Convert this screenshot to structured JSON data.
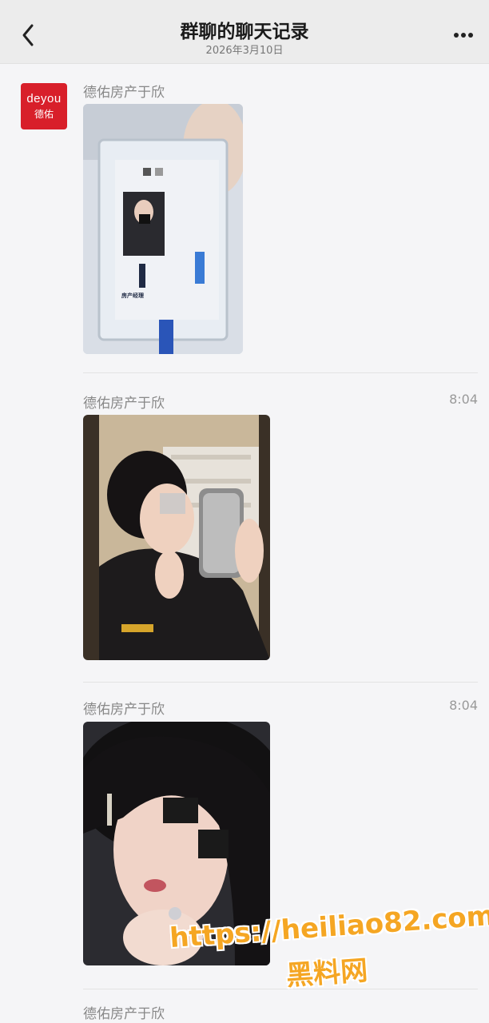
{
  "header": {
    "title": "群聊的聊天记录",
    "date": "2026年3月10日",
    "back_icon": "chevron-left-icon",
    "more_icon": "more-dots-icon"
  },
  "avatar": {
    "brand_text": "deyou",
    "brand_cn": "德佑",
    "color": "#d81f2a"
  },
  "messages": [
    {
      "sender": "德佑房产于欣",
      "time": "",
      "image": "employee-badge-photo",
      "badge_text": "房产经理"
    },
    {
      "sender": "德佑房产于欣",
      "time": "8:04",
      "image": "mirror-selfie-photo"
    },
    {
      "sender": "德佑房产于欣",
      "time": "8:04",
      "image": "portrait-selfie-photo"
    },
    {
      "sender": "德佑房产于欣",
      "time": ""
    }
  ],
  "watermark": {
    "url": "https://heiliao82.com",
    "name": "黑料网",
    "color": "#f5a623"
  }
}
